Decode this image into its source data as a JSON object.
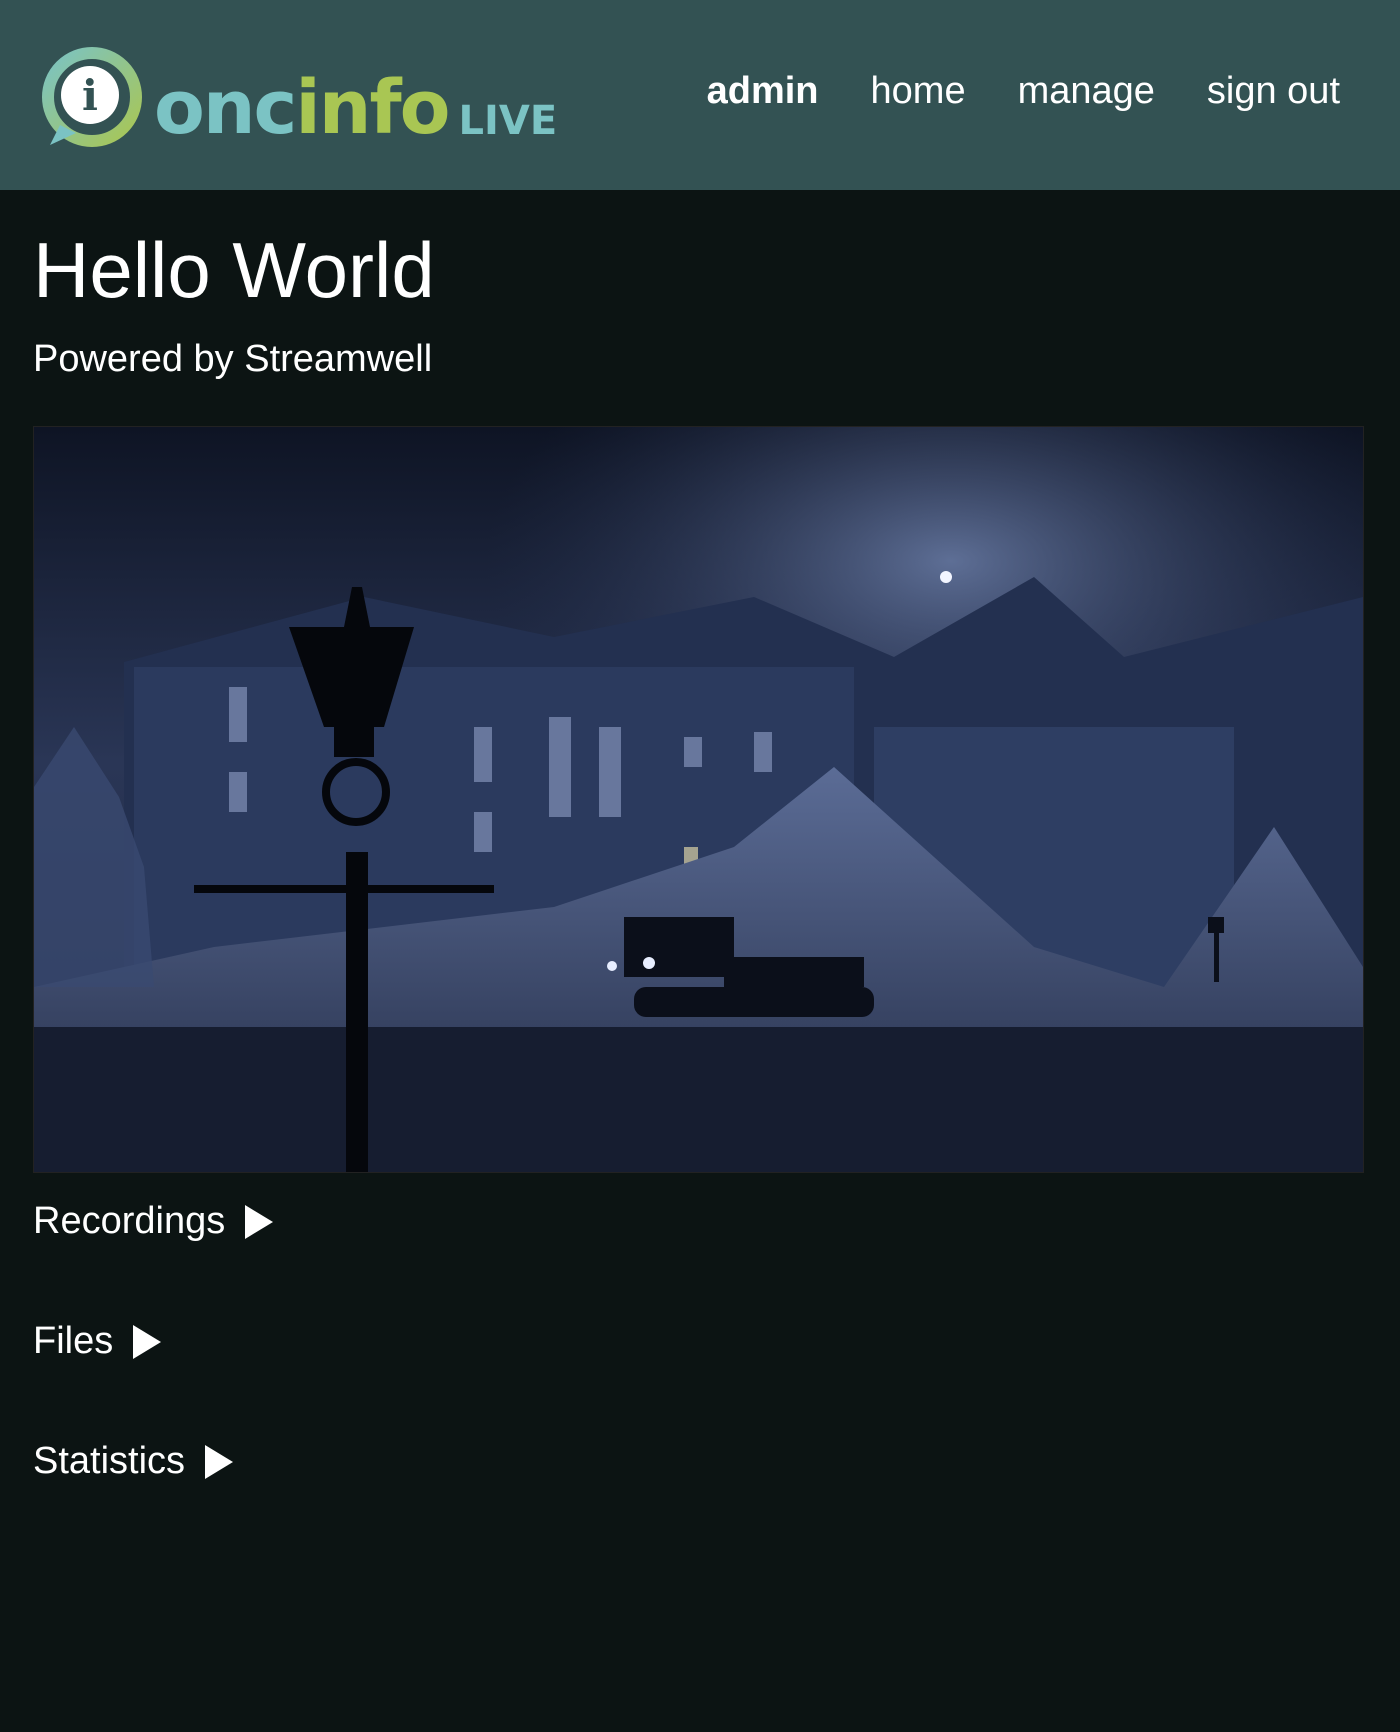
{
  "header": {
    "logo": {
      "badge_letter": "i",
      "text_onc": "onc",
      "text_info": "info",
      "text_live": "LIVE",
      "colors": {
        "teal": "#7bc3c4",
        "green": "#a9c653"
      }
    },
    "nav": {
      "admin": "admin",
      "home": "home",
      "manage": "manage",
      "sign_out": "sign out"
    },
    "background": "#335253"
  },
  "main": {
    "title": "Hello World",
    "subtitle": "Powered by Streamwell",
    "sections": {
      "recordings": "Recordings",
      "files": "Files",
      "statistics": "Statistics"
    },
    "section_icon": "play-triangle-icon"
  },
  "colors": {
    "page_background": "#0c1413",
    "text": "#ffffff"
  }
}
